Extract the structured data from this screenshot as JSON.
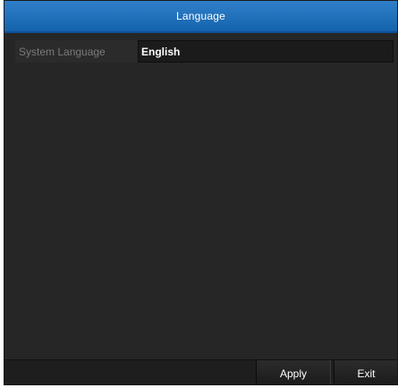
{
  "dialog": {
    "title": "Language"
  },
  "settings": {
    "system_language": {
      "label": "System Language",
      "value": "English"
    }
  },
  "footer": {
    "apply_label": "Apply",
    "exit_label": "Exit"
  },
  "colors": {
    "titlebar": "#1f6fbc",
    "background": "#262626",
    "text_primary": "#ffffff",
    "text_muted": "#7a7a7a"
  }
}
